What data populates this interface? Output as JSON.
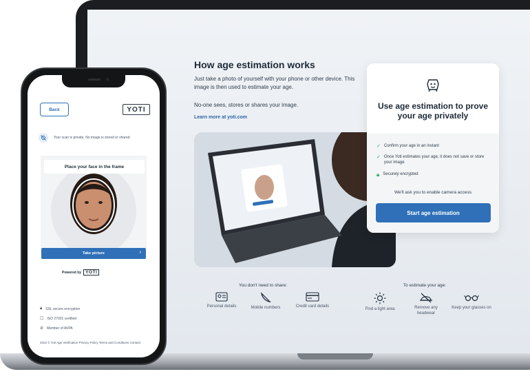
{
  "laptop": {
    "heading": "How age estimation works",
    "intro": "Just take a photo of yourself with your phone or other device. This image is then used to estimate your age.",
    "privacy": "No-one sees, stores or shares your image.",
    "learn_more": "Learn more at yoti.com",
    "card": {
      "title": "Use age estimation to prove your age privately",
      "checks": [
        "Confirm your age in an instant",
        "Once Yoti estimates your age, it does not save or store your image",
        "Securely encrypted"
      ],
      "camera_note": "We'll ask you to enable camera access",
      "start_button": "Start age estimation"
    },
    "dont_need_label": "You don't need to share:",
    "dont_need": [
      {
        "icon": "id-card-icon",
        "label": "Personal details"
      },
      {
        "icon": "phone-off-icon",
        "label": "Mobile numbers"
      },
      {
        "icon": "credit-card-icon",
        "label": "Credit card details"
      }
    ],
    "to_estimate_label": "To estimate your age:",
    "to_estimate": [
      {
        "icon": "sun-icon",
        "label": "Find a light area"
      },
      {
        "icon": "no-hat-icon",
        "label": "Remove any headwear"
      },
      {
        "icon": "glasses-icon",
        "label": "Keep your glasses on"
      }
    ]
  },
  "phone": {
    "back": "Back",
    "logo": "YOTI",
    "privacy": "Your scan is private. No image is stored or shared.",
    "frame_label": "Place your face in the frame",
    "take_picture": "Take picture",
    "powered_by": "Powered by",
    "badges": [
      "SSL secure encryption",
      "ISO 27001 certified",
      "Member of AVPA"
    ],
    "footer": "2022 © Yoti Age Verification   Privacy Policy   Terms and Conditions   Contact"
  },
  "colors": {
    "accent": "#2f70b8",
    "check": "#27a561",
    "text": "#1d2a38"
  }
}
